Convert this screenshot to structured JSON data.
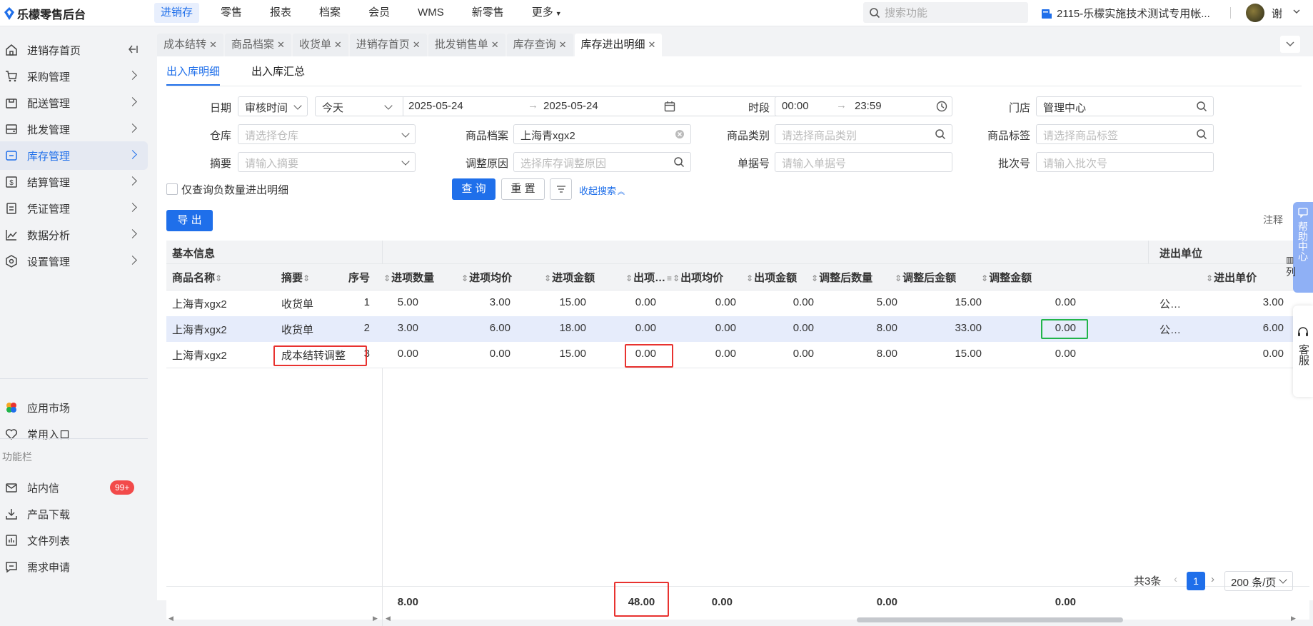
{
  "app": {
    "title": "乐檬零售后台"
  },
  "topnav": [
    "进销存",
    "零售",
    "报表",
    "档案",
    "会员",
    "WMS",
    "新零售",
    "更多"
  ],
  "search": {
    "placeholder": "搜索功能"
  },
  "account": {
    "name": "2115-乐檬实施技术测试专用帐...",
    "user": "谢"
  },
  "sidebar": {
    "items": [
      {
        "label": "进销存首页",
        "icon": "home-icon"
      },
      {
        "label": "采购管理",
        "icon": "cart-icon"
      },
      {
        "label": "配送管理",
        "icon": "box-icon"
      },
      {
        "label": "批发管理",
        "icon": "wholesale-icon"
      },
      {
        "label": "库存管理",
        "icon": "inventory-icon"
      },
      {
        "label": "结算管理",
        "icon": "dollar-icon"
      },
      {
        "label": "凭证管理",
        "icon": "voucher-icon"
      },
      {
        "label": "数据分析",
        "icon": "chart-icon"
      },
      {
        "label": "设置管理",
        "icon": "settings-icon"
      }
    ],
    "bottom": [
      {
        "label": "应用市场",
        "icon": "apps-icon"
      },
      {
        "label": "常用入口",
        "icon": "heart-icon"
      }
    ],
    "section_label": "功能栏",
    "tools": [
      {
        "label": "站内信",
        "icon": "mail-icon",
        "badge": "99+"
      },
      {
        "label": "产品下载",
        "icon": "download-icon"
      },
      {
        "label": "文件列表",
        "icon": "file-list-icon"
      },
      {
        "label": "需求申请",
        "icon": "request-icon"
      }
    ]
  },
  "tabs": [
    "成本结转",
    "商品档案",
    "收货单",
    "进销存首页",
    "批发销售单",
    "库存查询",
    "库存进出明细"
  ],
  "subtabs": [
    "出入库明细",
    "出入库汇总"
  ],
  "filters": {
    "date_label": "日期",
    "date_type": "审核时间",
    "date_range": "今天",
    "date_from": "2025-05-24",
    "date_to": "2025-05-24",
    "period_label": "时段",
    "time_from": "00:00",
    "time_to": "23:59",
    "store_label": "门店",
    "store_value": "管理中心",
    "warehouse_label": "仓库",
    "warehouse_ph": "请选择仓库",
    "product_label": "商品档案",
    "product_value": "上海青xgx2",
    "category_label": "商品类别",
    "category_ph": "请选择商品类别",
    "tag_label": "商品标签",
    "tag_ph": "请选择商品标签",
    "summary_label": "摘要",
    "summary_ph": "请输入摘要",
    "reason_label": "调整原因",
    "reason_ph": "选择库存调整原因",
    "docno_label": "单据号",
    "docno_ph": "请输入单据号",
    "batch_label": "批次号",
    "batch_ph": "请输入批次号",
    "negative_only": "仅查询负数量进出明细",
    "query_btn": "查 询",
    "reset_btn": "重 置",
    "collapse_link": "收起搜索"
  },
  "export_btn": "导 出",
  "note_label": "注释",
  "table": {
    "group_basic": "基本信息",
    "group_unit": "进出单位",
    "columns": [
      "商品名称",
      "摘要",
      "序号",
      "进项数量",
      "进项均价",
      "进项金额",
      "出项…",
      "出项均价",
      "出项金额",
      "调整后数量",
      "调整后金额",
      "调整金额",
      "进出单价"
    ],
    "rows": [
      {
        "name": "上海青xgx2",
        "summary": "收货单",
        "seq": "1",
        "in_qty": "5.00",
        "in_avg": "3.00",
        "in_amt": "15.00",
        "out_qty": "0.00",
        "out_avg": "0.00",
        "out_amt": "0.00",
        "adj_qty": "5.00",
        "adj_amt": "15.00",
        "adj_diff": "0.00",
        "unit": "公…",
        "unit_price": "3.00"
      },
      {
        "name": "上海青xgx2",
        "summary": "收货单",
        "seq": "2",
        "in_qty": "3.00",
        "in_avg": "6.00",
        "in_amt": "18.00",
        "out_qty": "0.00",
        "out_avg": "0.00",
        "out_amt": "0.00",
        "adj_qty": "8.00",
        "adj_amt": "33.00",
        "adj_diff": "0.00",
        "unit": "公…",
        "unit_price": "6.00"
      },
      {
        "name": "上海青xgx2",
        "summary": "成本结转调整",
        "seq": "3",
        "in_qty": "0.00",
        "in_avg": "0.00",
        "in_amt": "15.00",
        "out_qty": "0.00",
        "out_avg": "0.00",
        "out_amt": "0.00",
        "adj_qty": "8.00",
        "adj_amt": "15.00",
        "adj_diff": "0.00",
        "unit": "",
        "unit_price": "0.00"
      }
    ],
    "totals": {
      "in_qty": "8.00",
      "in_amt": "48.00",
      "out_qty": "0.00",
      "out_amt": "0.00",
      "adj_diff": "0.00"
    }
  },
  "pagination": {
    "total": "共3条",
    "page": "1",
    "page_size": "200 条/页"
  },
  "float": {
    "help": "帮助中心",
    "service": "客服",
    "columns": "列"
  }
}
